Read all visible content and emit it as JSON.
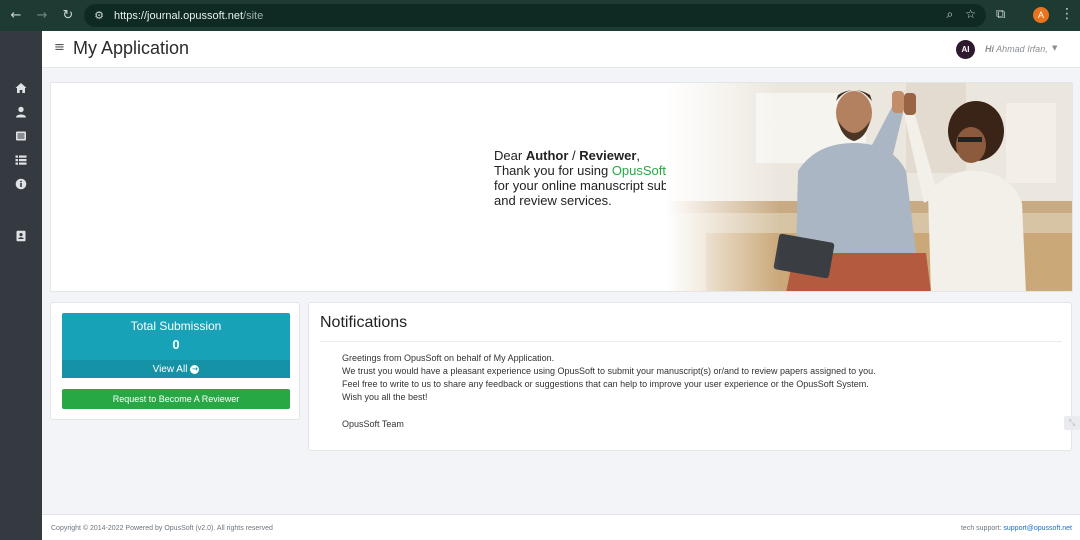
{
  "browser": {
    "back_icon": "arrow-left-icon",
    "forward_icon": "arrow-right-icon",
    "reload_icon": "reload-icon",
    "url_host": "https://journal.opussoft.net",
    "url_path": "/site",
    "profile_initial": "A"
  },
  "header": {
    "title": "My Application",
    "avatar_initials": "AI",
    "greeting_prefix": "Hi",
    "greeting_name": "Ahmad Irfan,"
  },
  "sidebar": {
    "items": [
      {
        "name": "home-icon"
      },
      {
        "name": "user-icon"
      },
      {
        "name": "document-list-icon"
      },
      {
        "name": "list-icon"
      },
      {
        "name": "info-icon"
      },
      {
        "name": "contact-icon"
      }
    ]
  },
  "banner": {
    "dear": "Dear",
    "author": "Author",
    "slash": "/",
    "reviewer": "Reviewer",
    "comma": ",",
    "thanks": "Thank you for using",
    "brand": "OpusSoft",
    "line3": "for your online manuscript submission",
    "line4": "and review services."
  },
  "stats": {
    "title": "Total Submission",
    "count": "0",
    "view_all": "View All",
    "reviewer_button": "Request to Become A Reviewer"
  },
  "notifications": {
    "title": "Notifications",
    "lines": [
      "Greetings from OpusSoft on behalf of My Application.",
      "We trust you would have a pleasant experience using OpusSoft to submit your manuscript(s) or/and to review papers assigned to you.",
      "Feel free to write to us to share any feedback or suggestions that can help to improve your user experience or the OpusSoft System.",
      "Wish you all the best!"
    ],
    "signature": "OpusSoft Team"
  },
  "footer": {
    "copyright": "Copyright © 2014-2022 Powered by OpusSoft (v2.0). All rights reserved",
    "support_label": "tech support:",
    "support_email": "support@opussoft.net"
  },
  "colors": {
    "sidebar": "#343a40",
    "info_box": "#17a2b8",
    "success": "#28a745",
    "browser_chrome": "#1d3b32"
  }
}
